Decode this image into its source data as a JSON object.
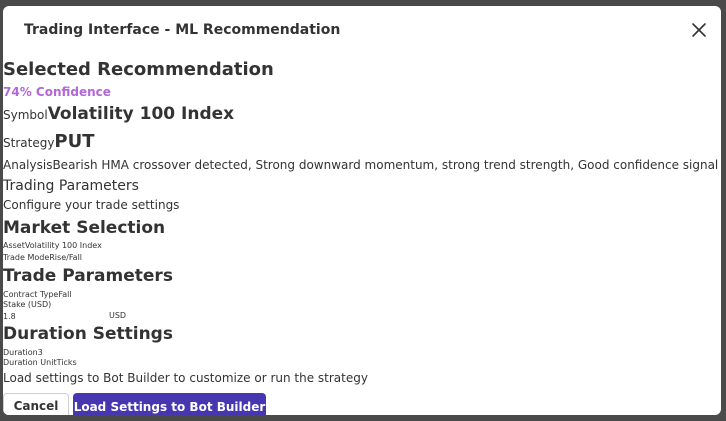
{
  "modal": {
    "title": "Trading Interface - ML Recommendation",
    "close_icon": "close-icon"
  },
  "recommendation": {
    "heading": "Selected Recommendation",
    "confidence": "74% Confidence",
    "symbol_label": "Symbol",
    "symbol_value": "Volatility 100 Index",
    "strategy_label": "Strategy",
    "strategy_value": "PUT",
    "analysis_label": "Analysis",
    "analysis_value": "Bearish HMA crossover detected, Strong downward momentum, strong trend strength, Good confidence signal"
  },
  "trading_parameters": {
    "title": "Trading Parameters",
    "subtitle": "Configure your trade settings"
  },
  "market_selection": {
    "title": "Market Selection",
    "asset_label": "Asset",
    "asset_value": "Volatility 100 Index",
    "trade_mode_label": "Trade Mode",
    "trade_mode_value": "Rise/Fall"
  },
  "trade_params": {
    "title": "Trade Parameters",
    "contract_type_label": "Contract Type",
    "contract_type_value": "Fall",
    "stake_label": "Stake (USD)",
    "stake_value": "1.8",
    "stake_currency": "USD"
  },
  "duration_settings": {
    "title": "Duration Settings",
    "duration_label": "Duration",
    "duration_value": "3",
    "duration_unit_label": "Duration Unit",
    "duration_unit_value": "Ticks"
  },
  "footer": {
    "note": "Load settings to Bot Builder to customize or run the strategy",
    "cancel_label": "Cancel",
    "load_label": "Load Settings to Bot Builder"
  },
  "colors": {
    "confidence": "#b367d6",
    "primary_button": "#4636b0",
    "backdrop": "#4a4a4a"
  }
}
